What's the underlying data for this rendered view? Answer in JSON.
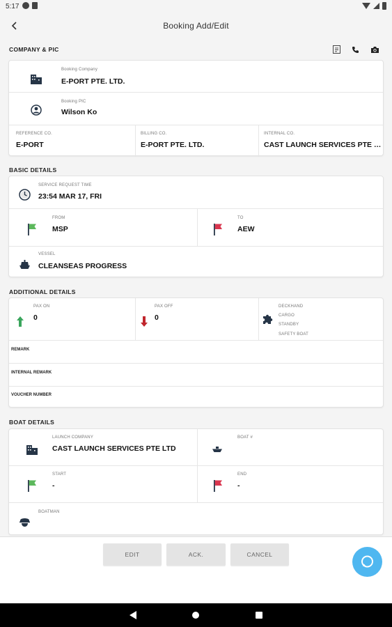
{
  "status_bar": {
    "time": "5:17"
  },
  "header": {
    "title": "Booking Add/Edit",
    "back_icon": "arrow-left-icon"
  },
  "company_pic": {
    "section_title": "COMPANY & PIC",
    "booking_company_label": "Booking Company",
    "booking_company": "E-PORT PTE. LTD.",
    "booking_pic_label": "Booking PIC",
    "booking_pic": "Wilson Ko",
    "reference_co_label": "REFERENCE CO.",
    "reference_co": "E-PORT",
    "billing_co_label": "BILLING CO.",
    "billing_co": "E-PORT PTE. LTD.",
    "internal_co_label": "INTERNAL CO.",
    "internal_co": "CAST LAUNCH SERVICES PTE LTD"
  },
  "basic_details": {
    "section_title": "BASIC DETAILS",
    "service_request_time_label": "SERVICE REQUEST TIME",
    "service_request_time": "23:54 MAR 17, FRI",
    "from_label": "FROM",
    "from": "MSP",
    "to_label": "TO",
    "to": "AEW",
    "vessel_label": "VESSEL",
    "vessel": "CLEANSEAS PROGRESS"
  },
  "additional_details": {
    "section_title": "ADDITIONAL DETAILS",
    "pax_on_label": "PAX ON",
    "pax_on": "0",
    "pax_off_label": "PAX OFF",
    "pax_off": "0",
    "services": [
      "DECKHAND",
      "CARGO",
      "STANDBY",
      "SAFETY BOAT"
    ],
    "remark_label": "REMARK",
    "internal_remark_label": "INTERNAL REMARK",
    "voucher_number_label": "VOUCHER NUMBER"
  },
  "boat_details": {
    "section_title": "BOAT DETAILS",
    "launch_company_label": "LAUNCH COMPANY",
    "launch_company": "CAST LAUNCH SERVICES PTE LTD",
    "boat_label": "BOAT #",
    "start_label": "START",
    "start": "-",
    "end_label": "END",
    "end": "-",
    "boatman_label": "BOATMAN"
  },
  "actions": {
    "edit": "EDIT",
    "ack": "ACK.",
    "cancel": "CANCEL"
  },
  "colors": {
    "flag_green": "#5cb85c",
    "flag_red": "#d9364f",
    "arrow_green": "#3aa55c",
    "arrow_red": "#c0262d",
    "fab": "#4fb7f0",
    "icon_dark": "#263547"
  }
}
